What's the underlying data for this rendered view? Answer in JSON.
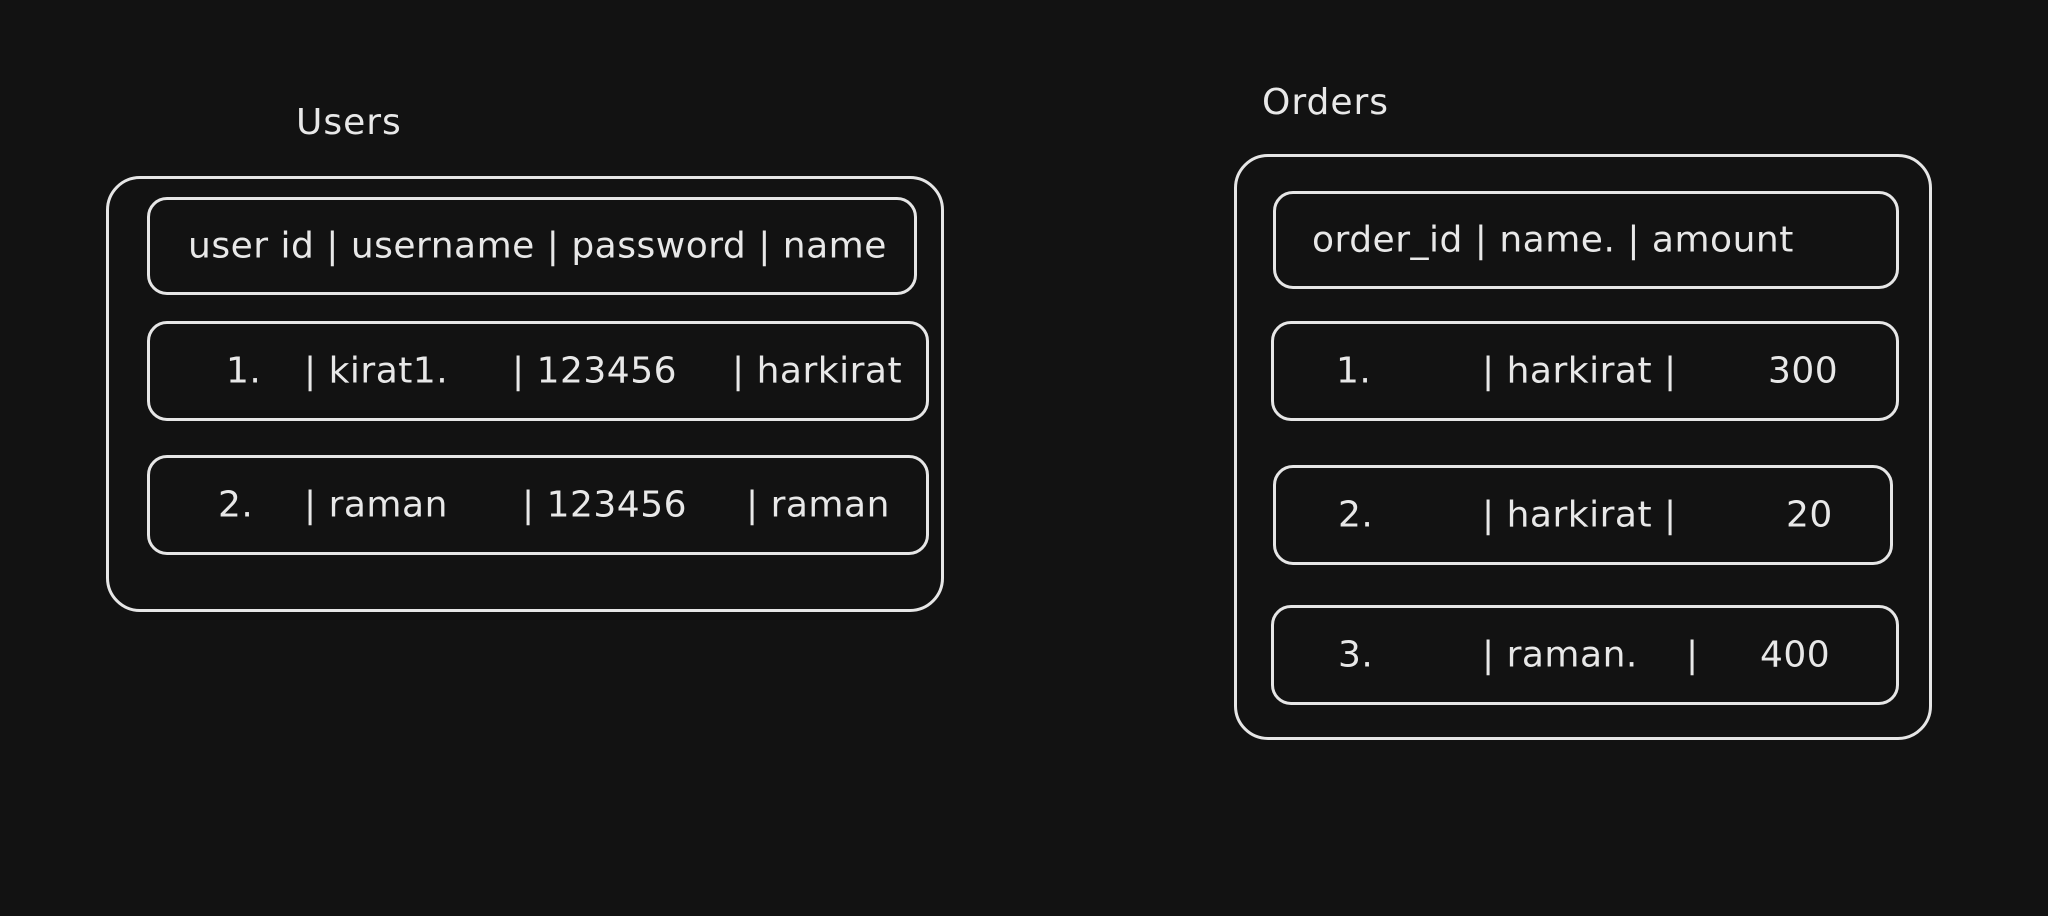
{
  "users": {
    "title": "Users",
    "header": "user id | username | password | name",
    "rows": [
      {
        "id": "1.",
        "c1": "| kirat1.",
        "c2": "| 123456",
        "c3": "| harkirat"
      },
      {
        "id": "2.",
        "c1": "|  raman",
        "c2": "| 123456",
        "c3": "| raman"
      }
    ]
  },
  "orders": {
    "title": "Orders",
    "header": "order_id |   name.    | amount",
    "rows": [
      {
        "id": "1.",
        "c1": "| harkirat |",
        "c2": "300"
      },
      {
        "id": "2.",
        "c1": "| harkirat |",
        "c2": "20"
      },
      {
        "id": "3.",
        "c1": "| raman.",
        "c2": "|",
        "c3": "400"
      }
    ]
  }
}
